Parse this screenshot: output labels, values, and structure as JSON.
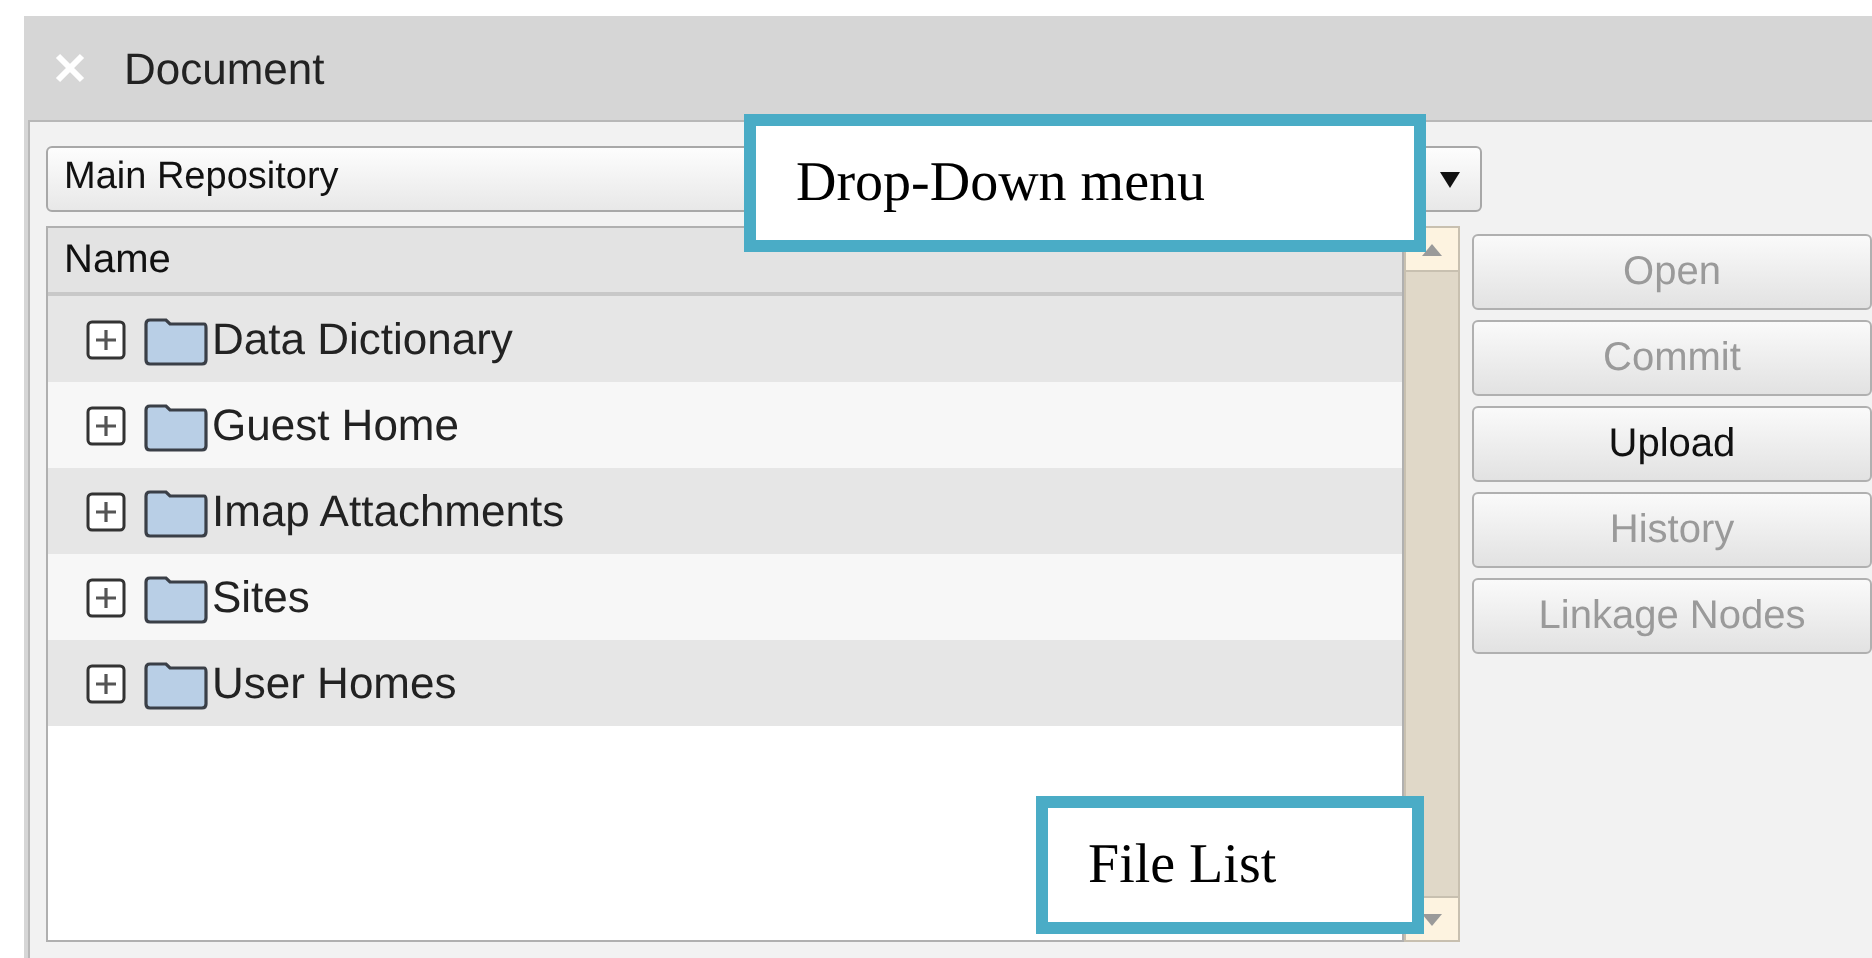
{
  "window": {
    "title": "Document"
  },
  "repository_dropdown": {
    "value": "Main Repository"
  },
  "file_list": {
    "column": "Name",
    "rows": [
      {
        "name": "Data Dictionary",
        "expanded": false
      },
      {
        "name": "Guest Home",
        "expanded": false
      },
      {
        "name": "Imap Attachments",
        "expanded": false
      },
      {
        "name": "Sites",
        "expanded": false
      },
      {
        "name": "User Homes",
        "expanded": false
      }
    ]
  },
  "buttons": [
    {
      "label": "Open",
      "disabled": true
    },
    {
      "label": "Commit",
      "disabled": true
    },
    {
      "label": "Upload",
      "disabled": false
    },
    {
      "label": "History",
      "disabled": true
    },
    {
      "label": "Linkage Nodes",
      "disabled": true
    }
  ],
  "callouts": [
    {
      "text": "Drop-Down menu"
    },
    {
      "text": "File List"
    }
  ]
}
